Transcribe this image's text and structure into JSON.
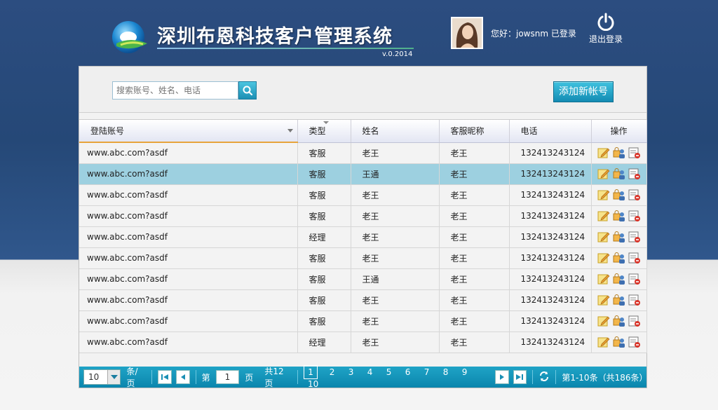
{
  "header": {
    "app_title": "深圳布恩科技客户管理系统",
    "version": "v.0.2014",
    "greeting": "您好：jowsnm 已登录",
    "logout_label": "退出登录"
  },
  "toolbar": {
    "search_placeholder": "搜索账号、姓名、电话",
    "add_label": "添加新帐号"
  },
  "table": {
    "columns": [
      "登陆账号",
      "类型",
      "姓名",
      "客服昵称",
      "电话",
      "操作"
    ],
    "rows": [
      {
        "account": "www.abc.com?asdf",
        "type": "客服",
        "name": "老王",
        "nickname": "老王",
        "phone": "132413243124"
      },
      {
        "account": "www.abc.com?asdf",
        "type": "客服",
        "name": "王通",
        "nickname": "老王",
        "phone": "132413243124"
      },
      {
        "account": "www.abc.com?asdf",
        "type": "客服",
        "name": "老王",
        "nickname": "老王",
        "phone": "132413243124"
      },
      {
        "account": "www.abc.com?asdf",
        "type": "客服",
        "name": "老王",
        "nickname": "老王",
        "phone": "132413243124"
      },
      {
        "account": "www.abc.com?asdf",
        "type": "经理",
        "name": "老王",
        "nickname": "老王",
        "phone": "132413243124"
      },
      {
        "account": "www.abc.com?asdf",
        "type": "客服",
        "name": "老王",
        "nickname": "老王",
        "phone": "132413243124"
      },
      {
        "account": "www.abc.com?asdf",
        "type": "客服",
        "name": "王通",
        "nickname": "老王",
        "phone": "132413243124"
      },
      {
        "account": "www.abc.com?asdf",
        "type": "客服",
        "name": "老王",
        "nickname": "老王",
        "phone": "132413243124"
      },
      {
        "account": "www.abc.com?asdf",
        "type": "客服",
        "name": "老王",
        "nickname": "老王",
        "phone": "132413243124"
      },
      {
        "account": "www.abc.com?asdf",
        "type": "经理",
        "name": "老王",
        "nickname": "老王",
        "phone": "132413243124"
      }
    ],
    "selected_row": 1,
    "row_actions": [
      "edit-icon",
      "user-lock-icon",
      "delete-icon"
    ]
  },
  "pager": {
    "page_size": "10",
    "per_page_label": "条/页",
    "page_prefix": "第",
    "current_page": "1",
    "page_suffix": "页",
    "total_pages": "共12页",
    "pages": [
      "1",
      "2",
      "3",
      "4",
      "5",
      "6",
      "7",
      "8",
      "9",
      "10"
    ],
    "summary": "第1-10条（共186条）"
  },
  "colors": {
    "header_bg": "#2c4d80",
    "accent": "#1fa3c6",
    "selected_row": "#9dd0e0"
  }
}
